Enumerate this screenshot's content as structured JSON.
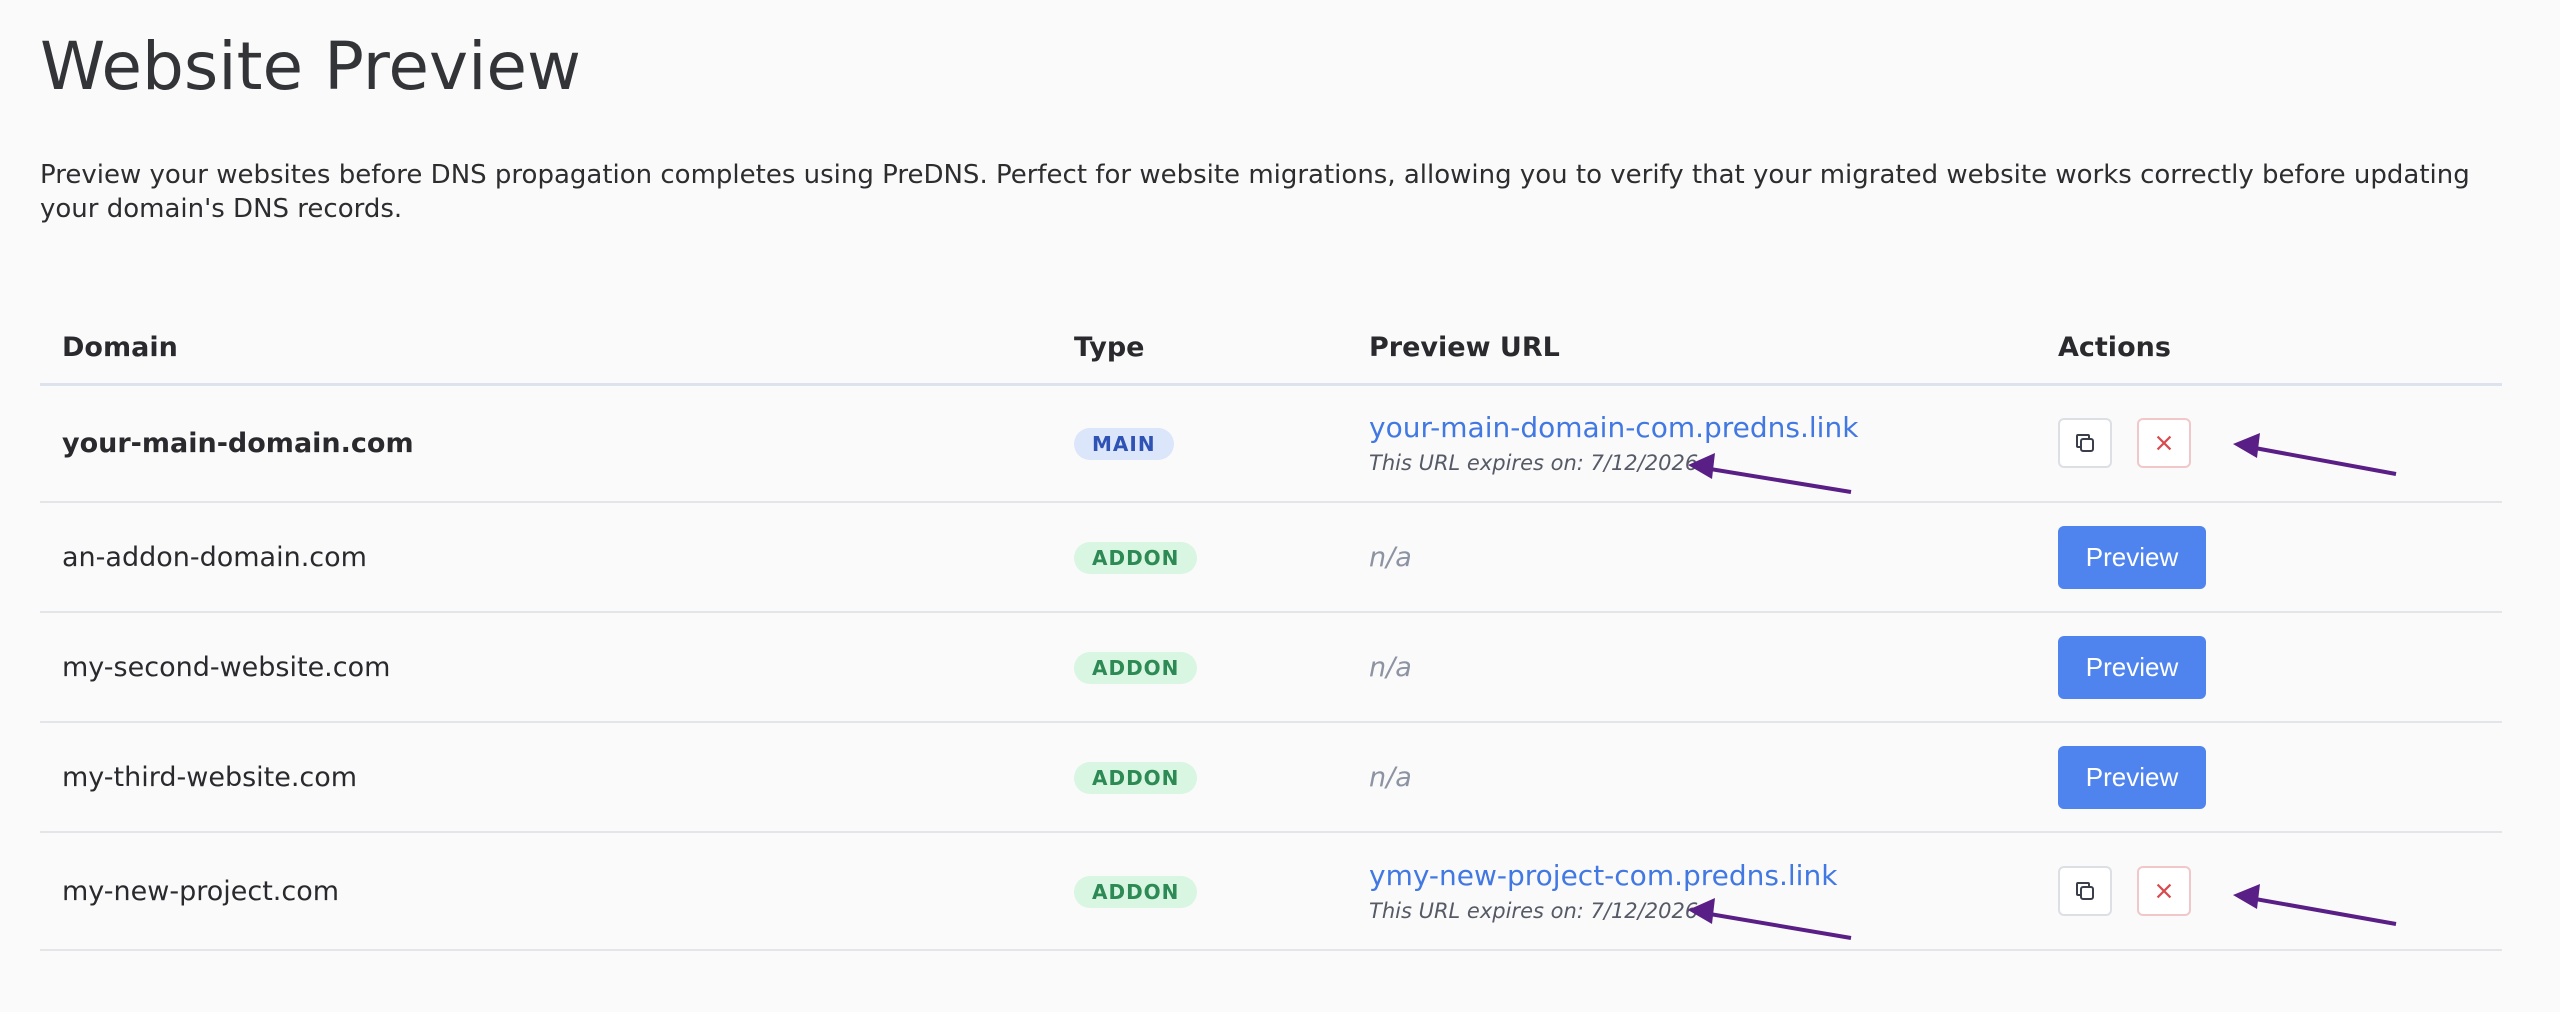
{
  "page": {
    "title": "Website Preview",
    "description": "Preview your websites before DNS propagation completes using PreDNS. Perfect for website migrations, allowing you to verify that your migrated website works correctly before updating your domain's DNS records."
  },
  "table": {
    "headers": {
      "domain": "Domain",
      "type": "Type",
      "preview_url": "Preview URL",
      "actions": "Actions"
    },
    "rows": [
      {
        "domain": "your-main-domain.com",
        "type": "MAIN",
        "preview_url": "your-main-domain-com.predns.link",
        "expires": "This URL expires on: 7/12/2026",
        "action": "copy-remove"
      },
      {
        "domain": "an-addon-domain.com",
        "type": "ADDON",
        "preview_url": "n/a",
        "action_label": "Preview"
      },
      {
        "domain": "my-second-website.com",
        "type": "ADDON",
        "preview_url": "n/a",
        "action_label": "Preview"
      },
      {
        "domain": "my-third-website.com",
        "type": "ADDON",
        "preview_url": "n/a",
        "action_label": "Preview"
      },
      {
        "domain": "my-new-project.com",
        "type": "ADDON",
        "preview_url": "ymy-new-project-com.predns.link",
        "expires": "This URL expires on: 7/12/2026",
        "action": "copy-remove"
      }
    ]
  },
  "colors": {
    "link": "#4278e2",
    "primary_button": "#4f84ef",
    "main_badge_bg": "#dbe6fb",
    "addon_badge_bg": "#d8f6e1",
    "remove_icon": "#d94a4e",
    "annotation_arrow": "#5a1f86"
  },
  "icons": {
    "copy": "copy-icon",
    "remove": "close-icon",
    "annotation": "arrow-annotation"
  }
}
